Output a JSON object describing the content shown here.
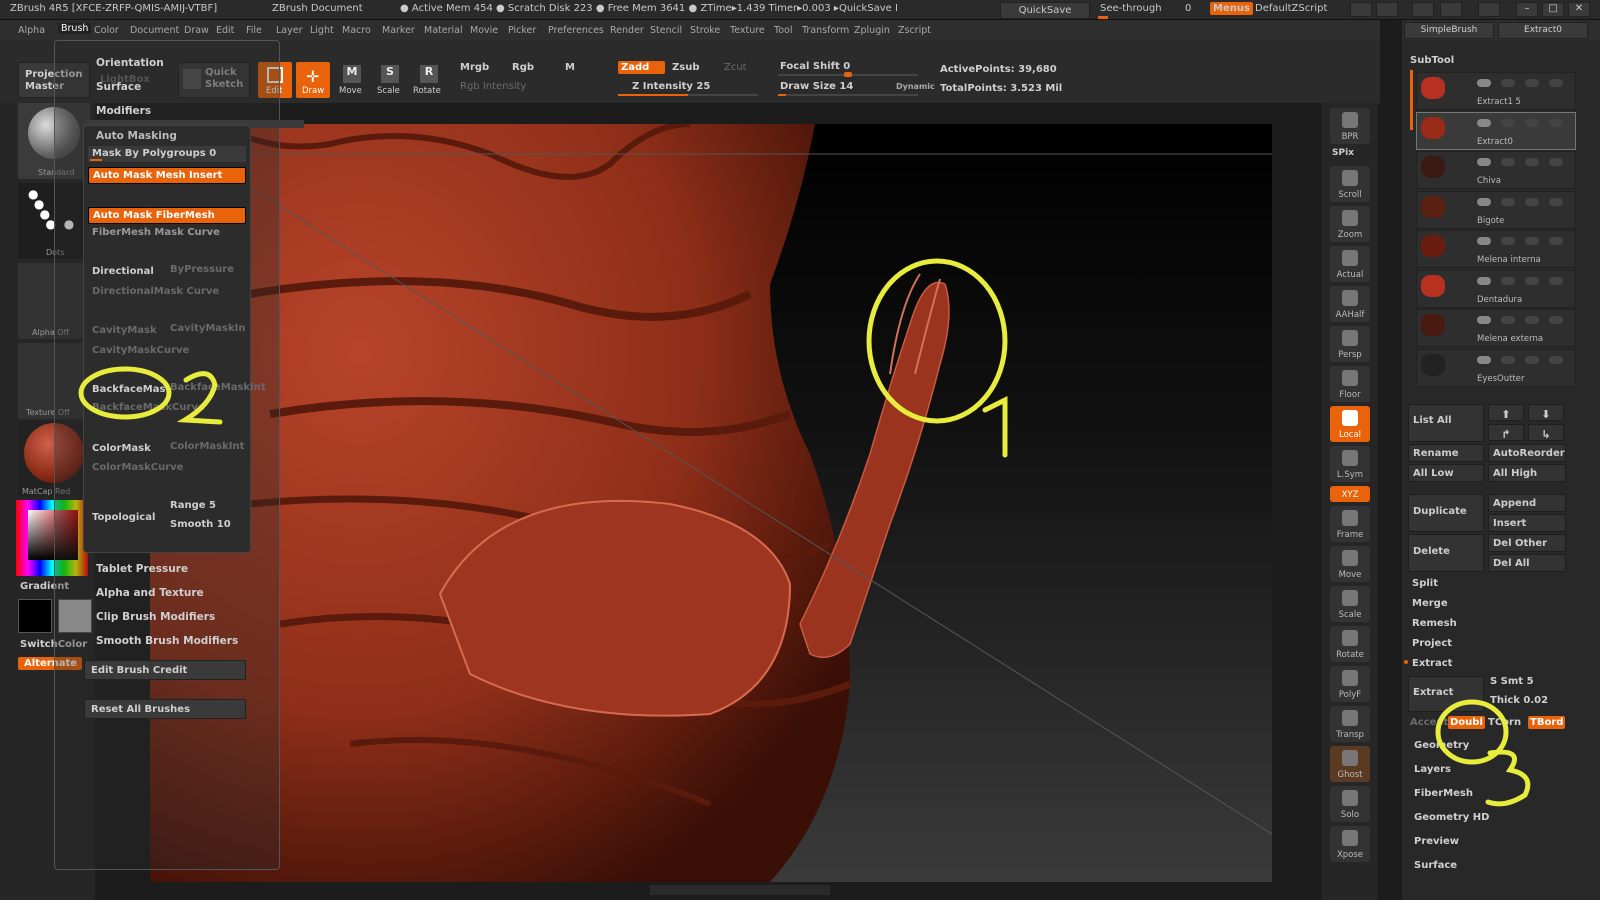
{
  "titlebar": {
    "app": "ZBrush 4R5 [XFCE-ZRFP-QMIS-AMIJ-VTBF]",
    "doc": "ZBrush Document",
    "stats": "● Active Mem 454 ● Scratch Disk 223 ● Free Mem 3641 ● ZTime▸1.439 Timer▸0.003 ▸QuickSave I",
    "quicksave": "QuickSave",
    "seethrough": "See-through",
    "seethrough_val": "0",
    "menus": "Menus",
    "script": "DefaultZScript"
  },
  "menubar": [
    "Alpha",
    "Brush",
    "Color",
    "Document",
    "Draw",
    "Edit",
    "File",
    "Layer",
    "Light",
    "Macro",
    "Marker",
    "Material",
    "Movie",
    "Picker",
    "Preferences",
    "Render",
    "Stencil",
    "Stroke",
    "Texture",
    "Tool",
    "Transform",
    "Zplugin",
    "Zscript"
  ],
  "toolbar": {
    "projection_master": "Projection Master",
    "lightbox": "LightBox",
    "quick_sketch": "Quick Sketch",
    "edit": "Edit",
    "draw": "Draw",
    "move": "Move",
    "scale": "Scale",
    "rotate": "Rotate",
    "mrgb": "Mrgb",
    "rgb": "Rgb",
    "m": "M",
    "rgb_intensity": "Rgb Intensity",
    "zadd": "Zadd",
    "zsub": "Zsub",
    "zcut": "Zcut",
    "z_intensity": "Z Intensity 25",
    "focal_shift": "Focal Shift 0",
    "draw_size": "Draw Size 14",
    "dynamic": "Dynamic",
    "active_points": "ActivePoints: 39,680",
    "total_points": "TotalPoints: 3.523 Mil",
    "z_intensity_level": 0.25,
    "draw_size_level": 0.14,
    "focal_shift_level": 0.5
  },
  "brush_menu": {
    "orientation": "Orientation",
    "surface": "Surface",
    "modifiers": "Modifiers",
    "auto_masking": "Auto Masking",
    "mask_by_polygroups": "Mask By Polygroups 0",
    "auto_mask_mesh_insert": "Auto Mask Mesh Insert",
    "auto_mask_fibermesh": "Auto Mask FiberMesh",
    "fibermesh_mask_curve": "FiberMesh Mask Curve",
    "directional": "Directional",
    "bypressure": "ByPressure",
    "directionalmask_curve": "DirectionalMask Curve",
    "cavitymask": "CavityMask",
    "cavitymaskint": "CavityMaskIn",
    "cavitymaskcurve": "CavityMaskCurve",
    "backfacemask": "BackfaceMas",
    "backfacemaskint": "BackfaceMaskInt",
    "backfacemaskcurve": "BackfaceMaskCurve",
    "colormask": "ColorMask",
    "colormaskint": "ColorMaskInt",
    "colormaskcurve": "ColorMaskCurve",
    "topological": "Topological",
    "range": "Range 5",
    "smooth": "Smooth 10",
    "tablet_pressure": "Tablet Pressure",
    "alpha_texture": "Alpha and Texture",
    "clip_brush": "Clip Brush Modifiers",
    "smooth_brush": "Smooth Brush Modifiers",
    "edit_credit": "Edit Brush Credit",
    "reset_all": "Reset All Brushes"
  },
  "left_shelf": {
    "standard": "Standard",
    "dots": "Dots",
    "alpha_off": "Alpha Off",
    "texture_off": "Texture Off",
    "matcap": "MatCap Red",
    "gradient": "Gradient",
    "switchcolor": "SwitchColor",
    "alternate": "Alternate"
  },
  "right_shelf": [
    "BPR",
    "SPix",
    "Scroll",
    "Zoom",
    "Actual",
    "AAHalf",
    "Persp",
    "Floor",
    "Local",
    "L.Sym",
    "XYZ",
    "Frame",
    "Move",
    "Scale",
    "Rotate",
    "PolyF",
    "Transp",
    "Ghost",
    "Solo",
    "Xpose"
  ],
  "subtool": {
    "header_buttons": [
      "SimpleBrush",
      "Extract0"
    ],
    "title": "SubTool",
    "items": [
      "Extract1 5",
      "Extract0",
      "Chiva",
      "Bigote",
      "Melena interna",
      "Dentadura",
      "Melena externa",
      "EyesOutter"
    ],
    "list_all": "List All",
    "rename": "Rename",
    "autoreorder": "AutoReorder",
    "all_low": "All Low",
    "all_high": "All High",
    "duplicate": "Duplicate",
    "append": "Append",
    "insert": "Insert",
    "delete": "Delete",
    "del_other": "Del Other",
    "del_all": "Del All",
    "split": "Split",
    "merge": "Merge",
    "remesh": "Remesh",
    "project": "Project",
    "extract_section": "Extract",
    "extract_btn": "Extract",
    "s_smt": "S Smt 5",
    "thick": "Thick 0.02",
    "accept": "Accept",
    "double": "Doubl",
    "tcorner": "TCorn",
    "tborder": "TBord"
  },
  "tool_sections": [
    "Geometry",
    "Layers",
    "FiberMesh",
    "Geometry HD",
    "Preview",
    "Surface"
  ],
  "annotations": [
    "1",
    "2",
    "3"
  ],
  "colors": {
    "accent": "#e8630a",
    "annotation": "#e8ec3c",
    "model": "#a8361c"
  }
}
